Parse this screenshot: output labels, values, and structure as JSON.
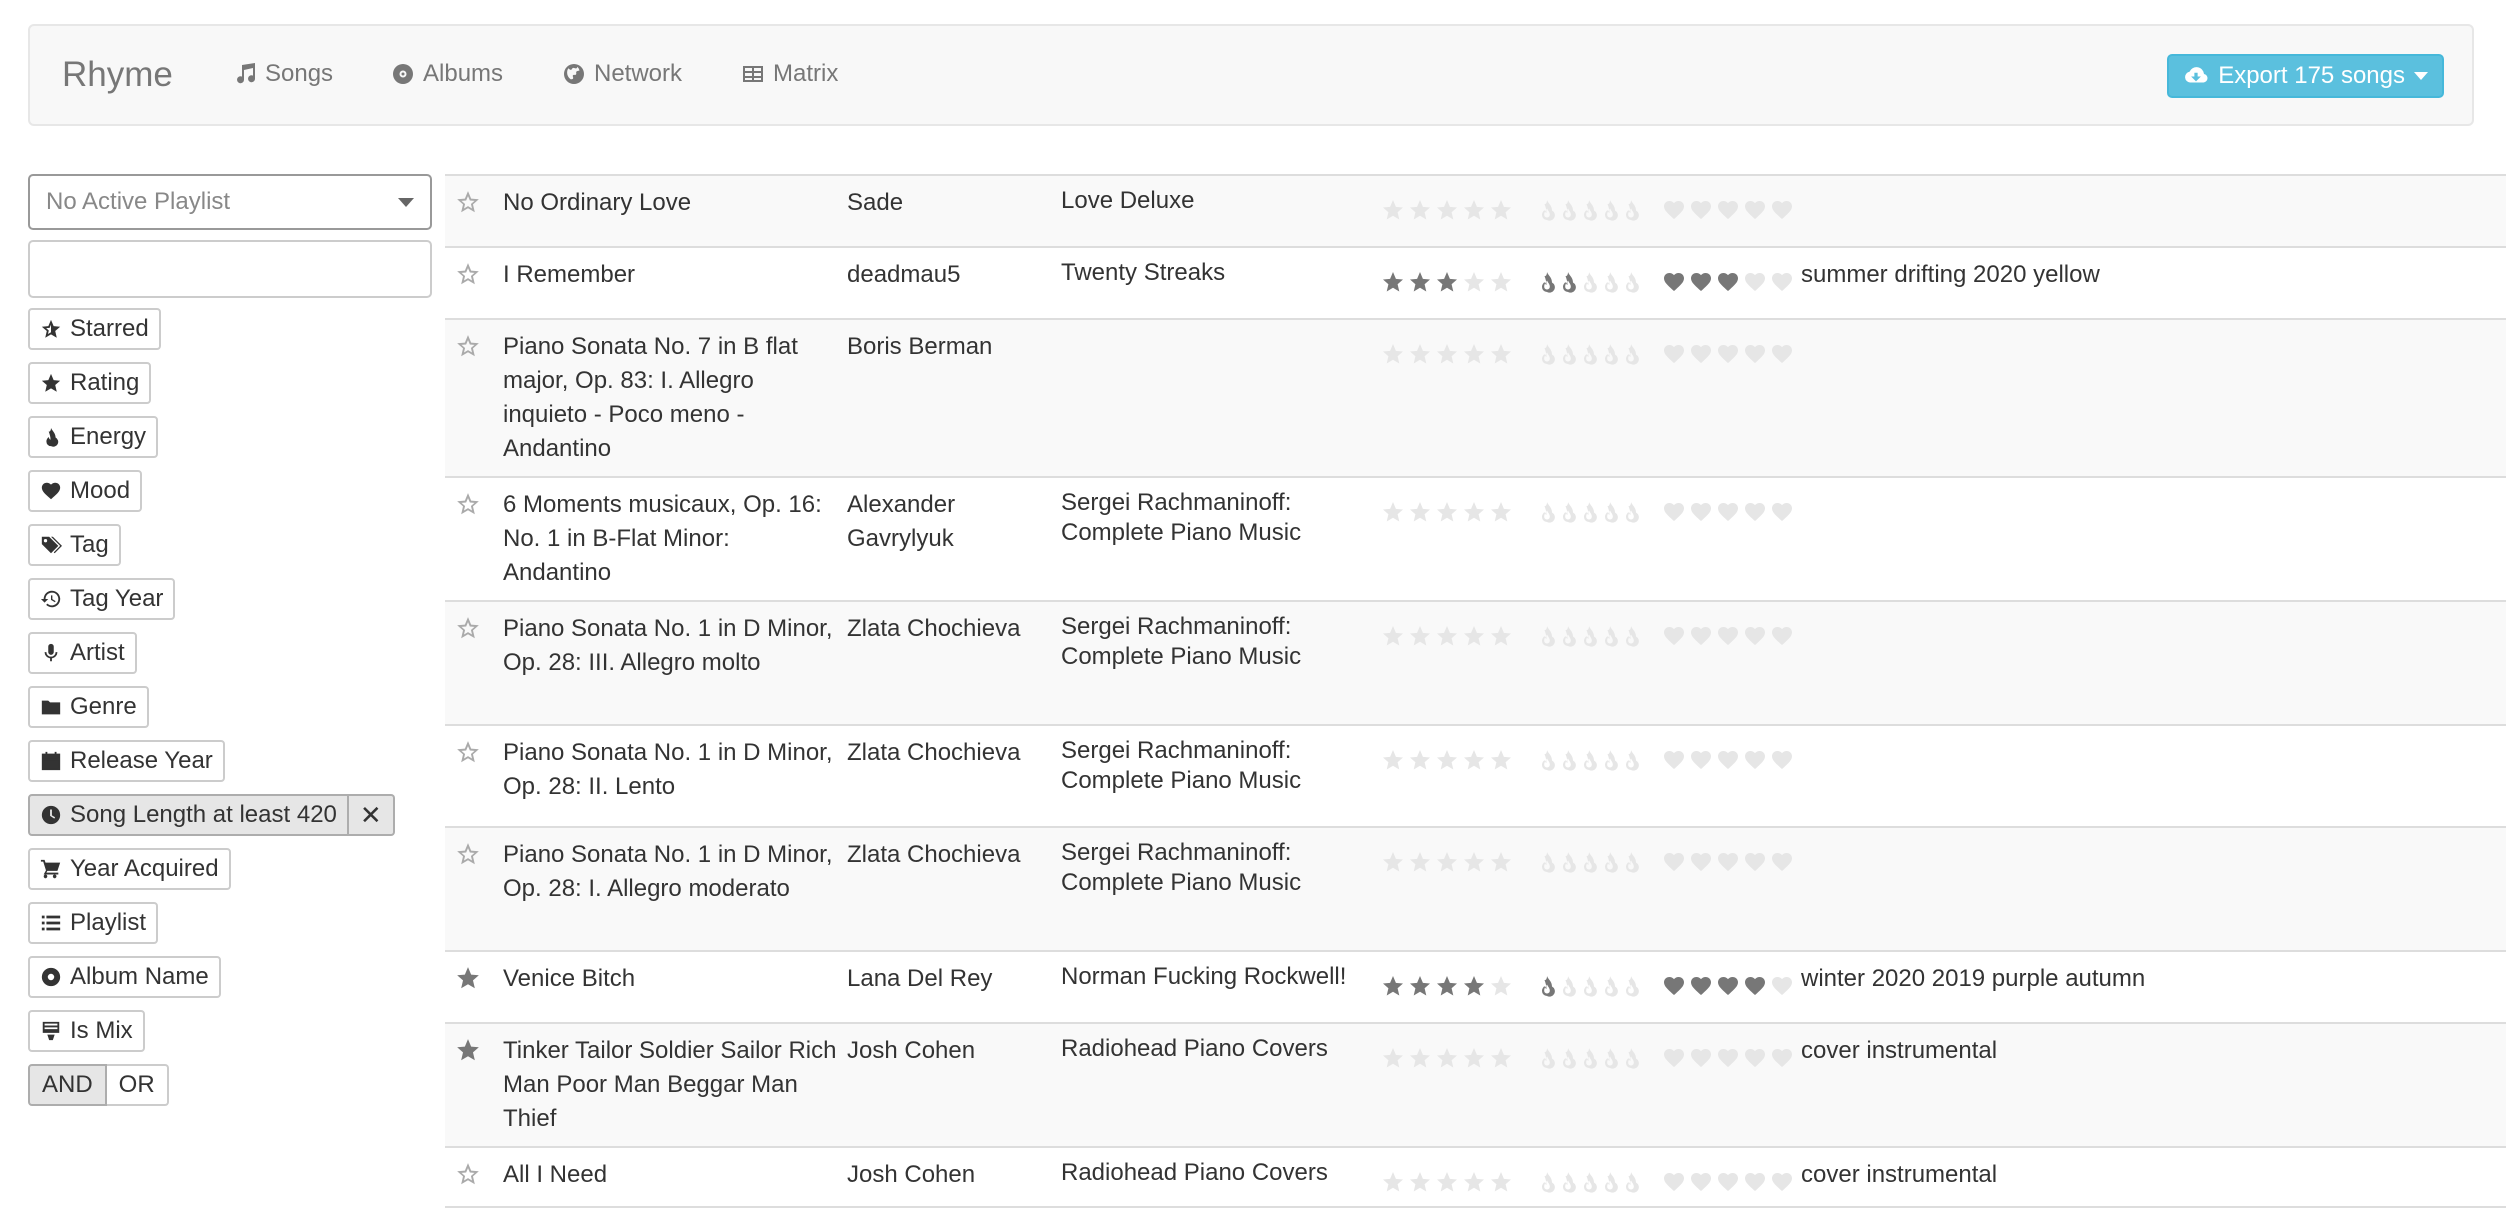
{
  "navbar": {
    "brand": "Rhyme",
    "links": [
      {
        "label": "Songs",
        "icon": "music-icon"
      },
      {
        "label": "Albums",
        "icon": "disc-icon"
      },
      {
        "label": "Network",
        "icon": "globe-icon"
      },
      {
        "label": "Matrix",
        "icon": "table-icon"
      }
    ],
    "export_label": "Export 175 songs"
  },
  "sidebar": {
    "playlist_select": "No Active Playlist",
    "search": {
      "value": "",
      "placeholder": ""
    },
    "filters": [
      {
        "label": "Starred",
        "icon": "star-outline-icon"
      },
      {
        "label": "Rating",
        "icon": "star-icon"
      },
      {
        "label": "Energy",
        "icon": "fire-icon"
      },
      {
        "label": "Mood",
        "icon": "heart-icon"
      },
      {
        "label": "Tag",
        "icon": "tags-icon"
      },
      {
        "label": "Tag Year",
        "icon": "history-icon"
      },
      {
        "label": "Artist",
        "icon": "microphone-icon"
      },
      {
        "label": "Genre",
        "icon": "folder-icon"
      },
      {
        "label": "Release Year",
        "icon": "calendar-icon"
      },
      {
        "label": "Song Length at least 420",
        "icon": "clock-icon",
        "active": true,
        "remove": "✕"
      },
      {
        "label": "Year Acquired",
        "icon": "cart-icon"
      },
      {
        "label": "Playlist",
        "icon": "list-icon"
      },
      {
        "label": "Album Name",
        "icon": "disc-icon"
      },
      {
        "label": "Is Mix",
        "icon": "mix-icon"
      }
    ],
    "logic": {
      "and_label": "AND",
      "or_label": "OR",
      "selected": "AND"
    }
  },
  "colors": {
    "accent": "#5bc0de",
    "rating_filled": "#777777",
    "rating_empty": "#e6e6e6"
  },
  "songs": [
    {
      "starred": false,
      "name": "No Ordinary Love",
      "artist": "Sade",
      "album": "Love Deluxe",
      "rating": 0,
      "energy": 0,
      "mood": 0,
      "tags": ""
    },
    {
      "starred": false,
      "name": "I Remember",
      "artist": "deadmau5",
      "album": "Twenty Streaks",
      "rating": 3,
      "energy": 2,
      "mood": 3,
      "tags": "summer drifting 2020 yellow"
    },
    {
      "starred": false,
      "name": "Piano Sonata No. 7 in B flat major, Op. 83: I. Allegro inquieto - Poco meno - Andantino",
      "artist": "Boris Berman",
      "album": "",
      "rating": 0,
      "energy": 0,
      "mood": 0,
      "tags": ""
    },
    {
      "starred": false,
      "name": "6 Moments musicaux, Op. 16: No. 1 in B-Flat Minor: Andantino",
      "artist": "Alexander Gavrylyuk",
      "album": "Sergei Rachmaninoff: Complete Piano Music",
      "rating": 0,
      "energy": 0,
      "mood": 0,
      "tags": ""
    },
    {
      "starred": false,
      "name": "Piano Sonata No. 1 in D Minor, Op. 28: III. Allegro molto",
      "artist": "Zlata Chochieva",
      "album": "Sergei Rachmaninoff: Complete Piano Music",
      "rating": 0,
      "energy": 0,
      "mood": 0,
      "tags": ""
    },
    {
      "starred": false,
      "name": "Piano Sonata No. 1 in D Minor, Op. 28: II. Lento",
      "artist": "Zlata Chochieva",
      "album": "Sergei Rachmaninoff: Complete Piano Music",
      "rating": 0,
      "energy": 0,
      "mood": 0,
      "tags": ""
    },
    {
      "starred": false,
      "name": "Piano Sonata No. 1 in D Minor, Op. 28: I. Allegro moderato",
      "artist": "Zlata Chochieva",
      "album": "Sergei Rachmaninoff: Complete Piano Music",
      "rating": 0,
      "energy": 0,
      "mood": 0,
      "tags": ""
    },
    {
      "starred": true,
      "name": "Venice Bitch",
      "artist": "Lana Del Rey",
      "album": "Norman Fucking Rockwell!",
      "rating": 4,
      "energy": 1,
      "mood": 4,
      "tags": "winter 2020 2019 purple autumn"
    },
    {
      "starred": true,
      "name": "Tinker Tailor Soldier Sailor Rich Man Poor Man Beggar Man Thief",
      "artist": "Josh Cohen",
      "album": "Radiohead Piano Covers",
      "rating": 0,
      "energy": 0,
      "mood": 0,
      "tags": "cover instrumental"
    },
    {
      "starred": false,
      "name": "All I Need",
      "artist": "Josh Cohen",
      "album": "Radiohead Piano Covers",
      "rating": 0,
      "energy": 0,
      "mood": 0,
      "tags": "cover instrumental"
    }
  ]
}
